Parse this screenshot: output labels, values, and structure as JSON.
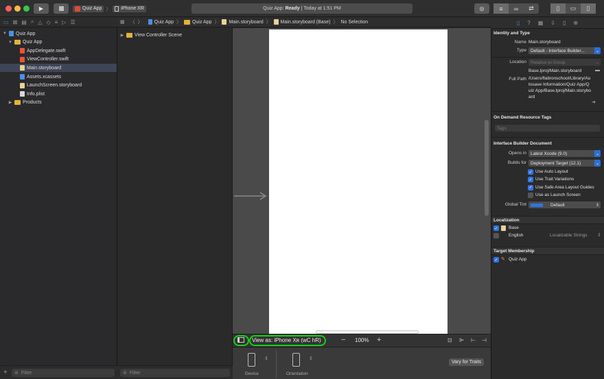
{
  "toolbar": {
    "scheme_app": "Quiz App",
    "scheme_device": "iPhone XR",
    "status_app": "Quiz App:",
    "status_state": "Ready",
    "status_time": "| Today at 1:51 PM",
    "run_icon": "play-icon",
    "stop_icon": "stop-icon"
  },
  "navigator": {
    "items": [
      {
        "label": "Quiz App",
        "kind": "project",
        "indent": 0,
        "expanded": true
      },
      {
        "label": "Quiz App",
        "kind": "folder",
        "indent": 1,
        "expanded": true
      },
      {
        "label": "AppDelegate.swift",
        "kind": "swift",
        "indent": 2
      },
      {
        "label": "ViewController.swift",
        "kind": "swift",
        "indent": 2
      },
      {
        "label": "Main.storyboard",
        "kind": "storyboard",
        "indent": 2,
        "selected": true
      },
      {
        "label": "Assets.xcassets",
        "kind": "assets",
        "indent": 2
      },
      {
        "label": "LaunchScreen.storyboard",
        "kind": "storyboard",
        "indent": 2
      },
      {
        "label": "Info.plist",
        "kind": "plist",
        "indent": 2
      },
      {
        "label": "Products",
        "kind": "folder",
        "indent": 1,
        "expanded": false
      }
    ],
    "filter_placeholder": "Filter"
  },
  "jumpbar": {
    "crumbs": [
      "Quiz App",
      "Quiz App",
      "Main.storyboard",
      "Main.storyboard (Base)",
      "No Selection"
    ]
  },
  "outline": {
    "scene": "View Controller Scene",
    "filter_placeholder": "Filter"
  },
  "canvas": {
    "view_as": "View as: iPhone Xʀ (wC hR)",
    "zoom": "100%",
    "zoom_out": "−",
    "zoom_in": "+",
    "device_label": "Device",
    "orientation_label": "Orientation",
    "vary_button": "Vary for Traits"
  },
  "inspector": {
    "identity_title": "Identity and Type",
    "name_label": "Name",
    "name_value": "Main.storyboard",
    "type_label": "Type",
    "type_value": "Default - Interface Builder...",
    "location_label": "Location",
    "location_value": "Relative to Group",
    "location_path": "Base.lproj/Main.storyboard",
    "fullpath_label": "Full Path",
    "fullpath_value": "/Users/flatironschool/Library/Autosave Information/Quiz App/Quiz App/Base.lproj/Main.storyboard",
    "odr_title": "On Demand Resource Tags",
    "tags_placeholder": "Tags",
    "ibdoc_title": "Interface Builder Document",
    "opens_in_label": "Opens in",
    "opens_in_value": "Latest Xcode (9.0)",
    "builds_for_label": "Builds for",
    "builds_for_value": "Deployment Target (12.1)",
    "checks": [
      {
        "label": "Use Auto Layout",
        "checked": true
      },
      {
        "label": "Use Trait Variations",
        "checked": true
      },
      {
        "label": "Use Safe Area Layout Guides",
        "checked": true
      },
      {
        "label": "Use as Launch Screen",
        "checked": false
      }
    ],
    "tint_label": "Global Tint",
    "tint_value": "Default",
    "tint_color": "#2f74e6",
    "loc_title": "Localization",
    "loc_items": [
      {
        "label": "Base",
        "checked": true
      },
      {
        "label": "English",
        "checked": false,
        "extra": "Localizable Strings"
      }
    ],
    "target_title": "Target Membership",
    "target_item": "Quiz App"
  },
  "colors": {
    "accent": "#2f74e6",
    "highlight": "#16d016",
    "folder": "#e3b23c"
  }
}
